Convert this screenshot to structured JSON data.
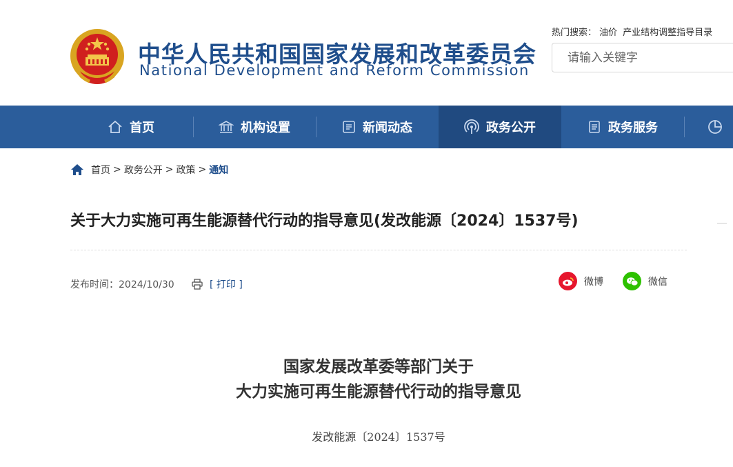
{
  "header": {
    "title_cn": "中华人民共和国国家发展和改革委员会",
    "title_en": "National Development and Reform Commission",
    "hot_search_label": "热门搜索：",
    "hot_search_links": [
      "油价",
      "产业结构调整指导目录"
    ],
    "search_placeholder": "请输入关键字",
    "emblem_icon": "national-emblem-icon"
  },
  "nav": {
    "items": [
      {
        "label": "首页",
        "icon": "home-icon"
      },
      {
        "label": "机构设置",
        "icon": "building-icon"
      },
      {
        "label": "新闻动态",
        "icon": "news-icon"
      },
      {
        "label": "政务公开",
        "icon": "broadcast-icon",
        "active": true
      },
      {
        "label": "政务服务",
        "icon": "document-icon"
      },
      {
        "label": "",
        "icon": "chart-icon"
      }
    ],
    "bg_color": "#2b5d9b",
    "active_color": "#204a80"
  },
  "breadcrumb": {
    "items": [
      "首页",
      "政务公开",
      "政策"
    ],
    "current": "通知",
    "separator": ">"
  },
  "article": {
    "title": "关于大力实施可再生能源替代行动的指导意见(发改能源〔2024〕1537号)",
    "publish_label": "发布时间：",
    "publish_date": "2024/10/30",
    "print_label": "[ 打印 ]",
    "share": {
      "weibo": "微博",
      "wechat": "微信"
    },
    "heading_line1": "国家发展改革委等部门关于",
    "heading_line2": "大力实施可再生能源替代行动的指导意见",
    "doc_number": "发改能源〔2024〕1537号"
  }
}
